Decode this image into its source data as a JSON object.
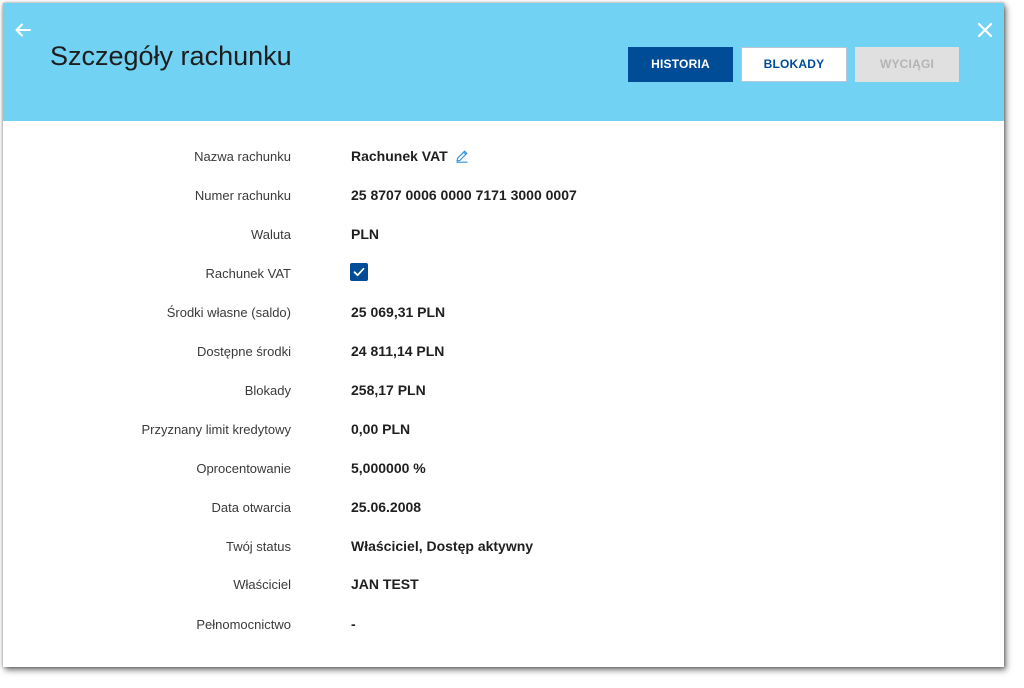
{
  "header": {
    "title": "Szczegóły rachunku",
    "back_icon": "arrow-left-icon",
    "close_icon": "close-icon",
    "background_color": "#72d2f3",
    "buttons": {
      "history": "HISTORIA",
      "blocks": "BLOKADY",
      "statements": "WYCIĄGI"
    },
    "accent_color": "#004c97"
  },
  "details": {
    "account_name": {
      "label": "Nazwa rachunku",
      "value": "Rachunek VAT",
      "icon": "pencil-icon"
    },
    "account_number": {
      "label": "Numer rachunku",
      "value": "25 8707 0006 0000 7171 3000 0007"
    },
    "currency": {
      "label": "Waluta",
      "value": "PLN"
    },
    "vat_account": {
      "label": "Rachunek VAT",
      "checked": true
    },
    "own_funds": {
      "label": "Środki własne (saldo)",
      "value": "25 069,31  PLN"
    },
    "available_funds": {
      "label": "Dostępne środki",
      "value": "24 811,14  PLN"
    },
    "blocks": {
      "label": "Blokady",
      "value": "258,17  PLN"
    },
    "credit_limit": {
      "label": "Przyznany limit kredytowy",
      "value": "0,00  PLN"
    },
    "interest": {
      "label": "Oprocentowanie",
      "value": "5,000000 %"
    },
    "opening_date": {
      "label": "Data otwarcia",
      "value": "25.06.2008"
    },
    "your_status": {
      "label": "Twój status",
      "value": "Właściciel,  Dostęp aktywny"
    },
    "owner": {
      "label": "Właściciel",
      "value": "JAN TEST"
    },
    "power_of_attorney": {
      "label": "Pełnomocnictwo",
      "value": "-"
    }
  }
}
